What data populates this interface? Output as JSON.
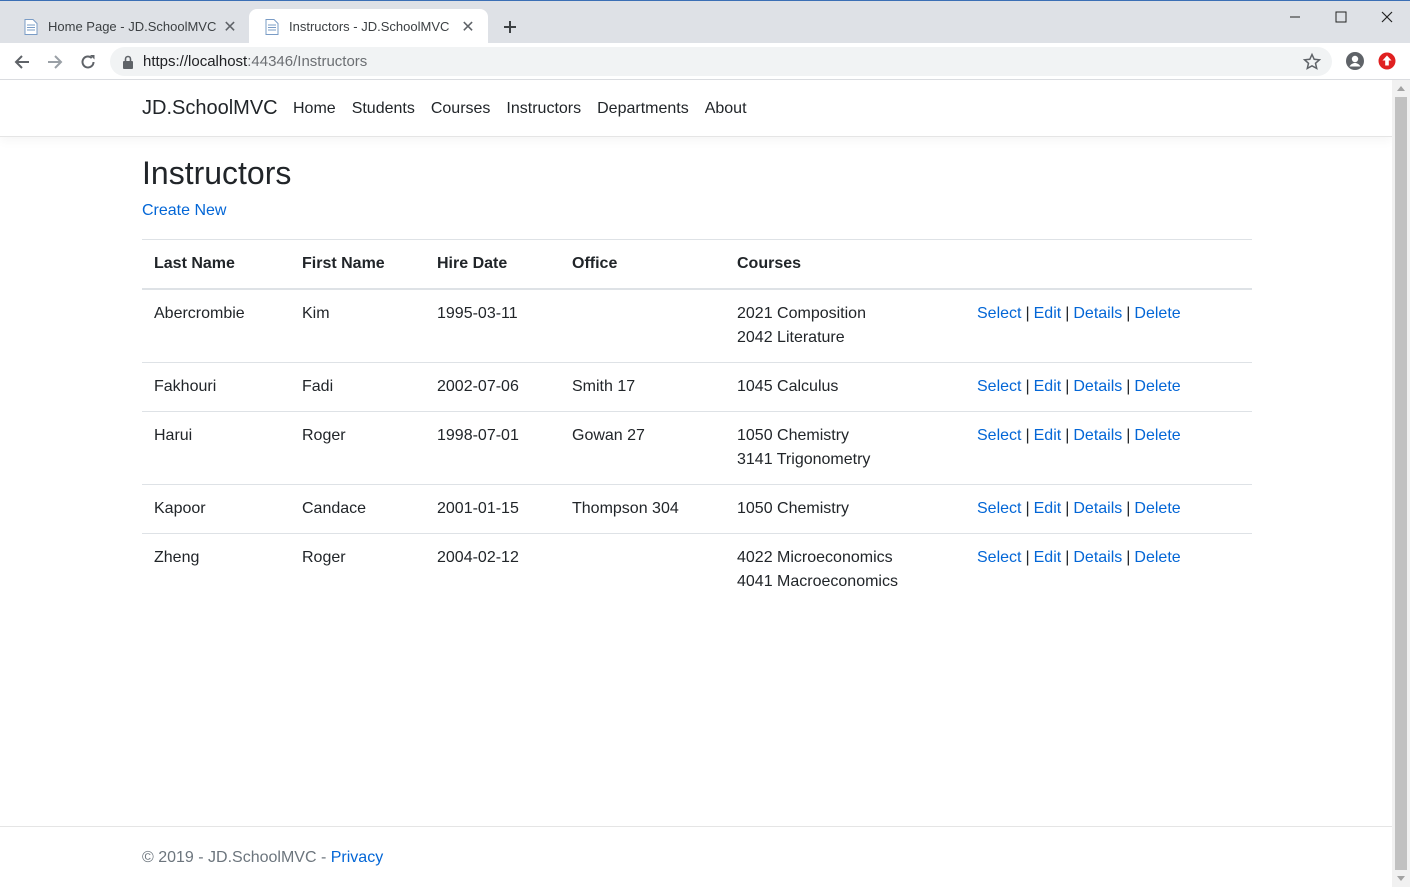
{
  "browser": {
    "tabs": [
      {
        "title": "Home Page - JD.SchoolMVC",
        "active": false
      },
      {
        "title": "Instructors - JD.SchoolMVC",
        "active": true
      }
    ],
    "url_host": "https://localhost",
    "url_rest": ":44346/Instructors",
    "icons": {
      "back": "back-arrow-icon",
      "forward": "forward-arrow-icon",
      "reload": "reload-icon",
      "lock": "lock-icon",
      "star": "bookmark-star-icon",
      "profile": "profile-icon",
      "extension": "extension-icon"
    }
  },
  "site": {
    "brand": "JD.SchoolMVC",
    "nav": [
      "Home",
      "Students",
      "Courses",
      "Instructors",
      "Departments",
      "About"
    ]
  },
  "page": {
    "title": "Instructors",
    "create_new": "Create New"
  },
  "table": {
    "headers": [
      "Last Name",
      "First Name",
      "Hire Date",
      "Office",
      "Courses"
    ],
    "actions": [
      "Select",
      "Edit",
      "Details",
      "Delete"
    ],
    "rows": [
      {
        "last": "Abercrombie",
        "first": "Kim",
        "hire": "1995-03-11",
        "office": "",
        "courses": [
          "2021 Composition",
          "2042 Literature"
        ]
      },
      {
        "last": "Fakhouri",
        "first": "Fadi",
        "hire": "2002-07-06",
        "office": "Smith 17",
        "courses": [
          "1045 Calculus"
        ]
      },
      {
        "last": "Harui",
        "first": "Roger",
        "hire": "1998-07-01",
        "office": "Gowan 27",
        "courses": [
          "1050 Chemistry",
          "3141 Trigonometry"
        ]
      },
      {
        "last": "Kapoor",
        "first": "Candace",
        "hire": "2001-01-15",
        "office": "Thompson 304",
        "courses": [
          "1050 Chemistry"
        ]
      },
      {
        "last": "Zheng",
        "first": "Roger",
        "hire": "2004-02-12",
        "office": "",
        "courses": [
          "4022 Microeconomics",
          "4041 Macroeconomics"
        ]
      }
    ]
  },
  "footer": {
    "text": "© 2019 - JD.SchoolMVC - ",
    "privacy": "Privacy"
  },
  "colors": {
    "link": "#0366d6",
    "text": "#212529",
    "muted": "#6c757d",
    "tabstrip": "#dee1e6"
  }
}
